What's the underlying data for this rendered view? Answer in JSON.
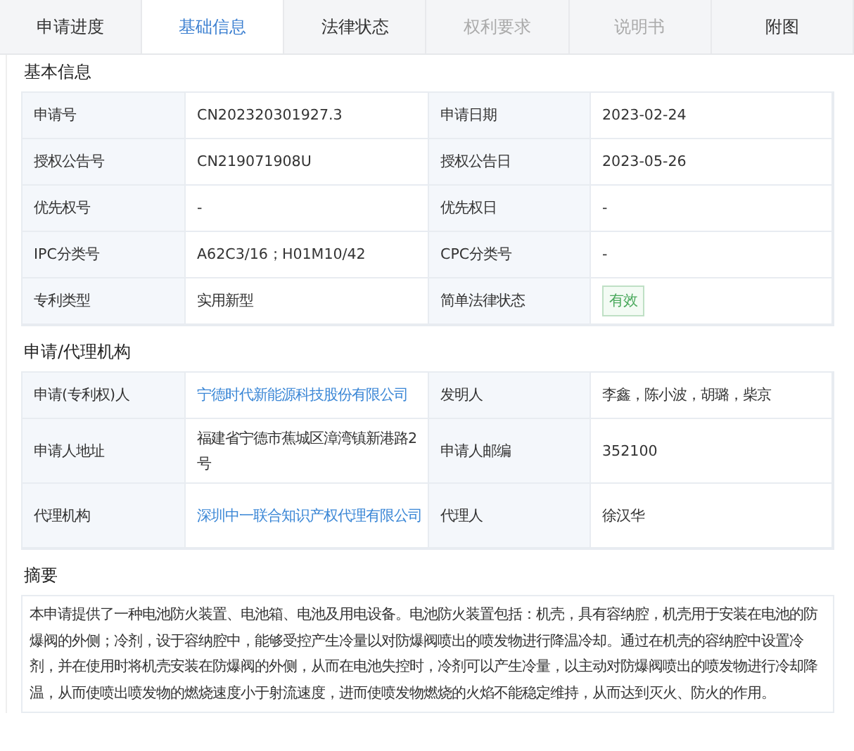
{
  "tabs": [
    {
      "label": "申请进度",
      "selected": false,
      "disabled": false
    },
    {
      "label": "基础信息",
      "selected": true,
      "disabled": false
    },
    {
      "label": "法律状态",
      "selected": false,
      "disabled": false
    },
    {
      "label": "权利要求",
      "selected": false,
      "disabled": true
    },
    {
      "label": "说明书",
      "selected": false,
      "disabled": true
    },
    {
      "label": "附图",
      "selected": false,
      "disabled": false
    }
  ],
  "basic_info": {
    "title": "基本信息",
    "rows": [
      {
        "label": "申请号",
        "value": {
          "kind": "text",
          "text": "CN202320301927.3"
        },
        "label_2": "申请日期",
        "value_2": {
          "kind": "text",
          "text": "2023-02-24"
        }
      },
      {
        "label": "授权公告号",
        "value": {
          "kind": "text",
          "text": "CN219071908U"
        },
        "label_2": "授权公告日",
        "value_2": {
          "kind": "text",
          "text": "2023-05-26"
        }
      },
      {
        "label": "优先权号",
        "value": {
          "kind": "text",
          "text": "-"
        },
        "label_2": "优先权日",
        "value_2": {
          "kind": "text",
          "text": "-"
        }
      },
      {
        "label": "IPC分类号",
        "value": {
          "kind": "text",
          "text": "A62C3/16；H01M10/42"
        },
        "label_2": "CPC分类号",
        "value_2": {
          "kind": "text",
          "text": "-"
        }
      },
      {
        "label": "专利类型",
        "value": {
          "kind": "text",
          "text": "实用新型"
        },
        "label_2": "简单法律状态",
        "value_2": {
          "kind": "tag",
          "text": "有效"
        }
      }
    ]
  },
  "agency": {
    "title": "申请/代理机构",
    "rows": [
      {
        "label": "申请(专利权)人",
        "value": {
          "kind": "link",
          "text": "宁德时代新能源科技股份有限公司"
        },
        "label_2": "发明人",
        "value_2": {
          "kind": "text",
          "text": "李鑫，陈小波，胡璐，柴京"
        }
      },
      {
        "label": "申请人地址",
        "value": {
          "kind": "text",
          "text": "福建省宁德市蕉城区漳湾镇新港路2号"
        },
        "label_2": "申请人邮编",
        "value_2": {
          "kind": "text",
          "text": "352100"
        }
      },
      {
        "label": "代理机构",
        "value": {
          "kind": "link",
          "text": "深圳中一联合知识产权代理有限公司"
        },
        "label_2": "代理人",
        "value_2": {
          "kind": "text",
          "text": "徐汉华"
        }
      }
    ]
  },
  "abstract": {
    "title": "摘要",
    "text": "本申请提供了一种电池防火装置、电池箱、电池及用电设备。电池防火装置包括：机壳，具有容纳腔，机壳用于安装在电池的防爆阀的外侧；冷剂，设于容纳腔中，能够受控产生冷量以对防爆阀喷出的喷发物进行降温冷却。通过在机壳的容纳腔中设置冷剂，并在使用时将机壳安装在防爆阀的外侧，从而在电池失控时，冷剂可以产生冷量，以主动对防爆阀喷出的喷发物进行冷却降温，从而使喷出喷发物的燃烧速度小于射流速度，进而使喷发物燃烧的火焰不能稳定维持，从而达到灭火、防火的作用。"
  }
}
